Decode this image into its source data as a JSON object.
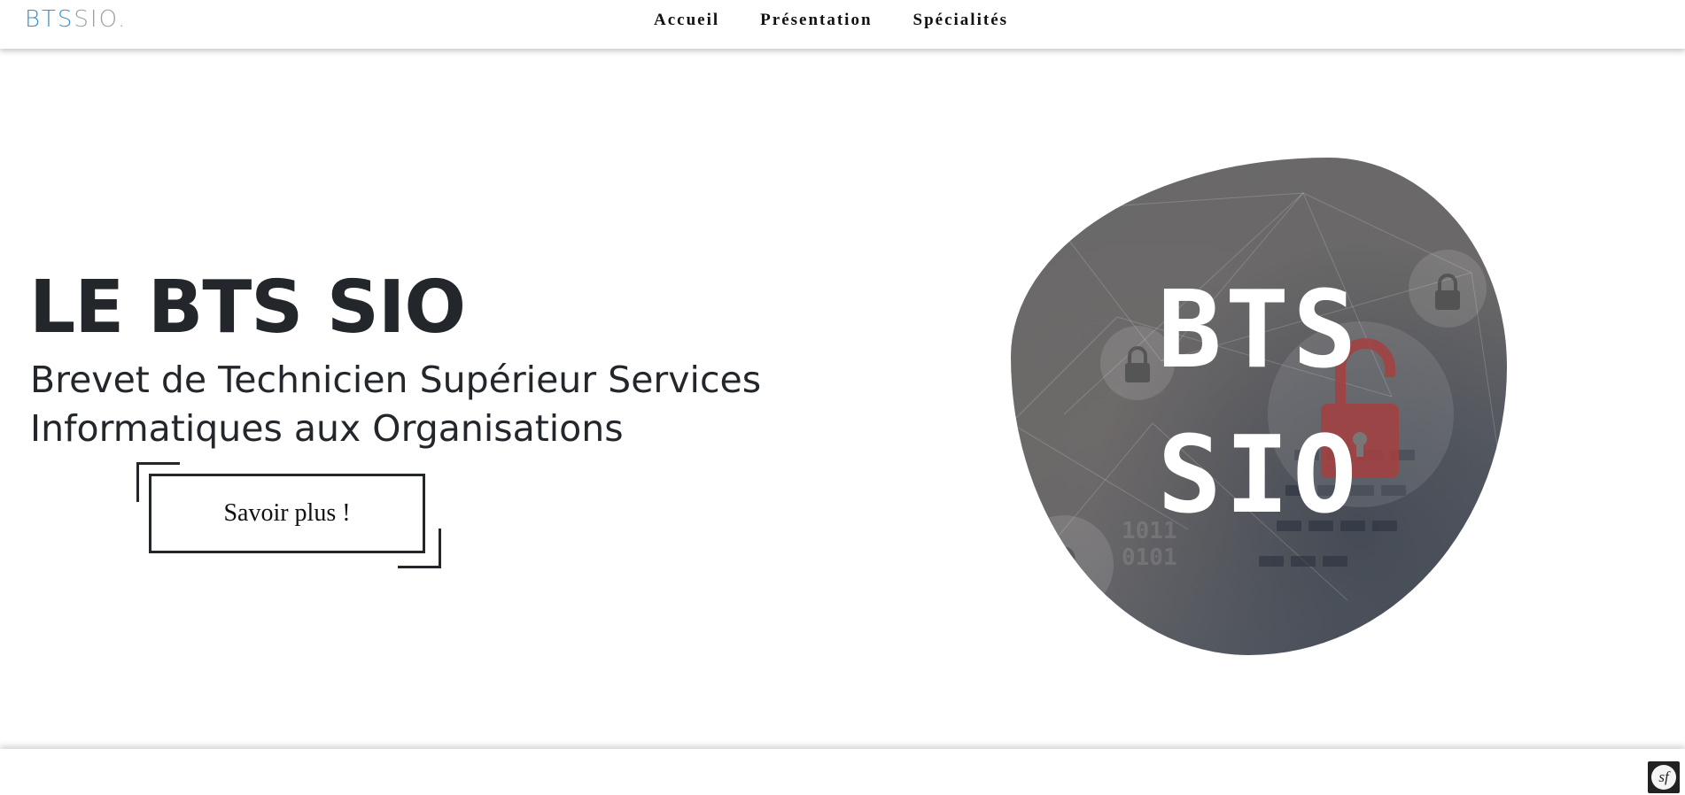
{
  "header": {
    "logo_part1": "BTS",
    "logo_part2": "SIO",
    "logo_dot": ".",
    "nav": [
      {
        "label": "Accueil"
      },
      {
        "label": "Présentation"
      },
      {
        "label": "Spécialités"
      }
    ]
  },
  "hero": {
    "title": "LE BTS SIO",
    "subtitle": "Brevet de Technicien Supérieur Services Informatiques aux Organisations",
    "cta_label": "Savoir plus !"
  },
  "image": {
    "line1": "BTS",
    "line2": "SIO",
    "icons": [
      "lock-icon",
      "unlock-icon"
    ]
  },
  "colors": {
    "logo_accent": "#3f8fc9",
    "logo_muted": "#9aa0a6",
    "text_dark": "#23272b",
    "lock_red": "#b23a3a"
  },
  "badge": {
    "icon": "symfony-icon",
    "glyph": "sf"
  }
}
